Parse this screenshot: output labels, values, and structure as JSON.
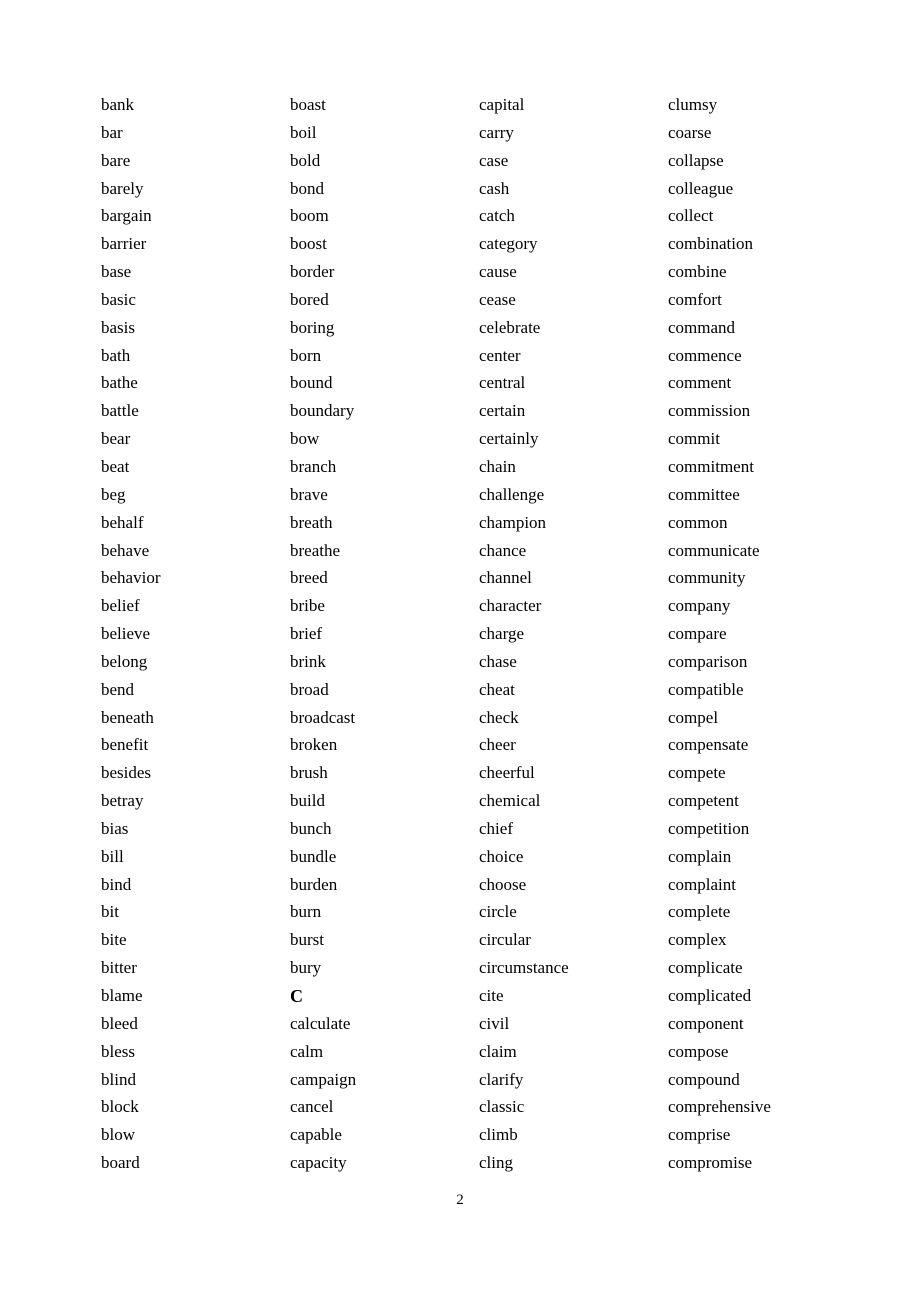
{
  "columns": [
    [
      "bank",
      "bar",
      "bare",
      "barely",
      "bargain",
      "barrier",
      "base",
      "basic",
      "basis",
      "bath",
      "bathe",
      "battle",
      "bear",
      "beat",
      "beg",
      "behalf",
      "behave",
      "behavior",
      "belief",
      "believe",
      "belong",
      "bend",
      "beneath",
      "benefit",
      "besides",
      "betray",
      "bias",
      "bill",
      "bind",
      "bit",
      "bite",
      "bitter",
      "blame",
      "bleed",
      "bless",
      "blind",
      "block",
      "blow",
      "board"
    ],
    [
      "boast",
      "boil",
      "bold",
      "bond",
      "boom",
      "boost",
      "border",
      "bored",
      "boring",
      "born",
      "bound",
      "boundary",
      "bow",
      "branch",
      "brave",
      "breath",
      "breathe",
      "breed",
      "bribe",
      "brief",
      "brink",
      "broad",
      "broadcast",
      "broken",
      "brush",
      "build",
      "bunch",
      "bundle",
      "burden",
      "burn",
      "burst",
      "bury",
      "C",
      "calculate",
      "calm",
      "campaign",
      "cancel",
      "capable",
      "capacity"
    ],
    [
      "capital",
      "carry",
      "case",
      "cash",
      "catch",
      "category",
      "cause",
      "cease",
      "celebrate",
      "center",
      "central",
      "certain",
      "certainly",
      "chain",
      "challenge",
      "champion",
      "chance",
      "channel",
      "character",
      "charge",
      "chase",
      "cheat",
      "check",
      "cheer",
      "cheerful",
      "chemical",
      "chief",
      "choice",
      "choose",
      "circle",
      "circular",
      "circumstance",
      "cite",
      "civil",
      "claim",
      "clarify",
      "classic",
      "climb",
      "cling"
    ],
    [
      "clumsy",
      "coarse",
      "collapse",
      "colleague",
      "collect",
      "combination",
      "combine",
      "comfort",
      "command",
      "commence",
      "comment",
      "commission",
      "commit",
      "commitment",
      "committee",
      "common",
      "communicate",
      "community",
      "company",
      "compare",
      "comparison",
      "compatible",
      "compel",
      "compensate",
      "compete",
      "competent",
      "competition",
      "complain",
      "complaint",
      "complete",
      "complex",
      "complicate",
      "complicated",
      "component",
      "compose",
      "compound",
      "comprehensive",
      "comprise",
      "compromise"
    ]
  ],
  "section_headings": [
    "C"
  ],
  "page_number": "2"
}
